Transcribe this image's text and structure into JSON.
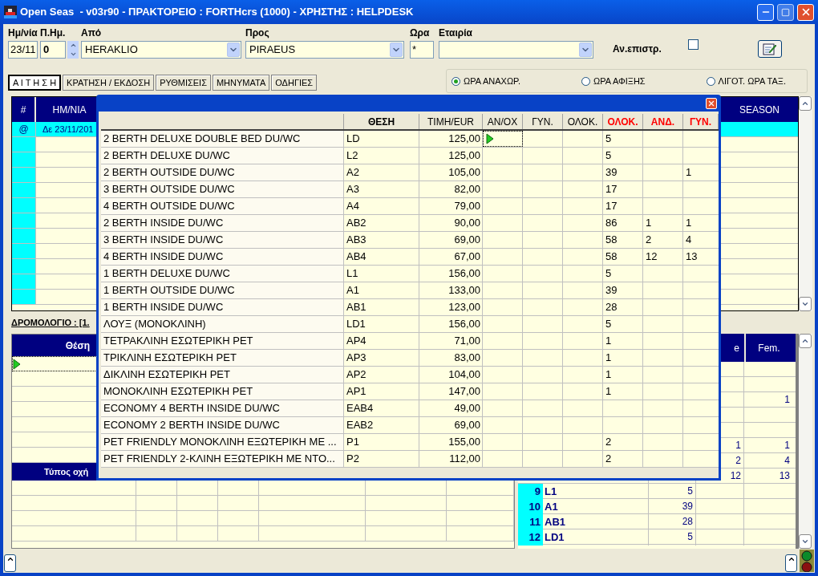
{
  "window": {
    "title": "Open Seas  - v03r90 - ΠΡΑΚΤΟΡΕΙΟ : FORTHcrs (1000) - ΧΡΗΣΤΗΣ : HELPDESK"
  },
  "search_form": {
    "date": {
      "label": "Ημ/νία",
      "value": "23/11"
    },
    "days": {
      "label": "Π.Ημ.",
      "value": "0"
    },
    "from": {
      "label": "Από",
      "value": "HERAKLIO"
    },
    "to": {
      "label": "Προς",
      "value": "PIRAEUS"
    },
    "time": {
      "label": "Ωρα",
      "value": "*"
    },
    "company": {
      "label": "Εταιρία"
    },
    "return_trip": {
      "label": "Αν.επιστρ.",
      "checked": false
    }
  },
  "tabs": [
    {
      "label": "Α Ι Τ Η Σ Η",
      "selected": true
    },
    {
      "label": "ΚΡΑΤΗΣΗ / ΕΚΔΟΣΗ",
      "selected": false
    },
    {
      "label": "ΡΥΘΜΙΣΕΙΣ",
      "selected": false
    },
    {
      "label": "ΜΗΝΥΜΑΤΑ",
      "selected": false
    },
    {
      "label": "ΟΔΗΓΙΕΣ",
      "selected": false
    }
  ],
  "time_mode": [
    {
      "label": "ΩΡΑ ΑΝΑΧΩΡ.",
      "selected": true
    },
    {
      "label": "ΩΡΑ ΑΦΙΞΗΣ",
      "selected": false
    },
    {
      "label": "ΛΙΓΟΤ. ΩΡΑ ΤΑΞ.",
      "selected": false
    }
  ],
  "trips_table": {
    "columns": [
      "#",
      "ΗΜ/ΝΙΑ",
      "SEASON"
    ],
    "rows": [
      {
        "marker": "@",
        "date": "Δε 23/11/201",
        "selected": true
      }
    ]
  },
  "route_label": "ΔΡΟΜΟΛΟΓΙΟ : [1.",
  "seats_table": {
    "columns": [
      "Θέση"
    ],
    "rows": [
      {
        "current": true
      }
    ]
  },
  "vehicles_table": {
    "columns": [
      "Τύπος οχή"
    ]
  },
  "availability_table": {
    "columns": [
      "e",
      "Fem."
    ],
    "rows": [
      {},
      {},
      {
        "female": "1"
      },
      {},
      {},
      {
        "male": "1",
        "female": "1"
      },
      {
        "male": "2",
        "female": "4"
      },
      {
        "male": "12",
        "female": "13"
      },
      {
        "num": "9",
        "code": "L1",
        "total": "5"
      },
      {
        "num": "10",
        "code": "A1",
        "total": "39"
      },
      {
        "num": "11",
        "code": "AB1",
        "total": "28"
      },
      {
        "num": "12",
        "code": "LD1",
        "total": "5"
      }
    ]
  },
  "cabin_popup": {
    "columns": [
      {
        "label": "ΘΕΣΗ",
        "bold": true,
        "color": "#000000"
      },
      {
        "label": "ΤΙΜΗ/EUR",
        "bold": false,
        "color": "#000000"
      },
      {
        "label": "ΑΝ/ΟΧ",
        "bold": false,
        "color": "#000000"
      },
      {
        "label": "ΓΥΝ.",
        "bold": false,
        "color": "#000000"
      },
      {
        "label": "ΟΛΟΚ.",
        "bold": false,
        "color": "#000000"
      },
      {
        "label": "ΟΛΟΚ.",
        "bold": true,
        "color": "#ff0000"
      },
      {
        "label": "ΑΝΔ.",
        "bold": true,
        "color": "#ff0000"
      },
      {
        "label": "ΓΥΝ.",
        "bold": true,
        "color": "#ff0000"
      }
    ],
    "rows": [
      {
        "name": "2 BERTH DELUXE DOUBLE BED DU/WC",
        "code": "LD",
        "price": "125,00",
        "total": "5",
        "current": true
      },
      {
        "name": "2 BERTH DELUXE DU/WC",
        "code": "L2",
        "price": "125,00",
        "total": "5",
        "current": false
      },
      {
        "name": "2 BERTH OUTSIDE DU/WC",
        "code": "A2",
        "price": "105,00",
        "total": "39",
        "female": "1",
        "current": false
      },
      {
        "name": "3 BERTH OUTSIDE DU/WC",
        "code": "A3",
        "price": "82,00",
        "total": "17",
        "current": false
      },
      {
        "name": "4 BERTH OUTSIDE DU/WC",
        "code": "A4",
        "price": "79,00",
        "total": "17",
        "current": false
      },
      {
        "name": "2 BERTH INSIDE DU/WC",
        "code": "AB2",
        "price": "90,00",
        "total": "86",
        "male": "1",
        "female": "1",
        "current": false
      },
      {
        "name": "3 BERTH INSIDE DU/WC",
        "code": "AB3",
        "price": "69,00",
        "total": "58",
        "male": "2",
        "female": "4",
        "current": false
      },
      {
        "name": "4 BERTH INSIDE DU/WC",
        "code": "AB4",
        "price": "67,00",
        "total": "58",
        "male": "12",
        "female": "13",
        "current": false
      },
      {
        "name": "1 BERTH DELUXE DU/WC",
        "code": "L1",
        "price": "156,00",
        "total": "5",
        "current": false
      },
      {
        "name": "1 BERTH OUTSIDE DU/WC",
        "code": "A1",
        "price": "133,00",
        "total": "39",
        "current": false
      },
      {
        "name": "1 BERTH INSIDE DU/WC",
        "code": "AB1",
        "price": "123,00",
        "total": "28",
        "current": false
      },
      {
        "name": "ΛΟΥΞ (ΜΟΝΟΚΛΙΝΗ)",
        "code": "LD1",
        "price": "156,00",
        "total": "5",
        "current": false
      },
      {
        "name": "ΤΕΤΡΑΚΛΙΝΗ ΕΣΩΤΕΡΙΚΗ PET",
        "code": "AP4",
        "price": "71,00",
        "total": "1",
        "current": false
      },
      {
        "name": "ΤΡΙΚΛΙΝΗ ΕΣΩΤΕΡΙΚΗ PET",
        "code": "AP3",
        "price": "83,00",
        "total": "1",
        "current": false
      },
      {
        "name": "ΔΙΚΛΙΝΗ ΕΣΩΤΕΡΙΚΗ PET",
        "code": "AP2",
        "price": "104,00",
        "total": "1",
        "current": false
      },
      {
        "name": "ΜΟΝΟΚΛΙΝΗ ΕΣΩΤΕΡΙΚΗ PET",
        "code": "AP1",
        "price": "147,00",
        "total": "1",
        "current": false
      },
      {
        "name": "ECONOMY 4 BERTH INSIDE DU/WC",
        "code": "EAB4",
        "price": "49,00",
        "current": false
      },
      {
        "name": "ECONOMY 2 BERTH INSIDE DU/WC",
        "code": "EAB2",
        "price": "69,00",
        "current": false
      },
      {
        "name": "PET FRIENDLY ΜΟΝΟΚΛΙΝΗ ΕΞΩΤΕΡΙΚΗ ΜΕ ...",
        "code": "P1",
        "price": "155,00",
        "total": "2",
        "current": false
      },
      {
        "name": "PET FRIENDLY 2-ΚΛΙΝΗ ΕΞΩΤΕΡΙΚΗ ΜΕ ΝΤΟ...",
        "code": "P2",
        "price": "112,00",
        "total": "2",
        "current": false
      }
    ]
  }
}
